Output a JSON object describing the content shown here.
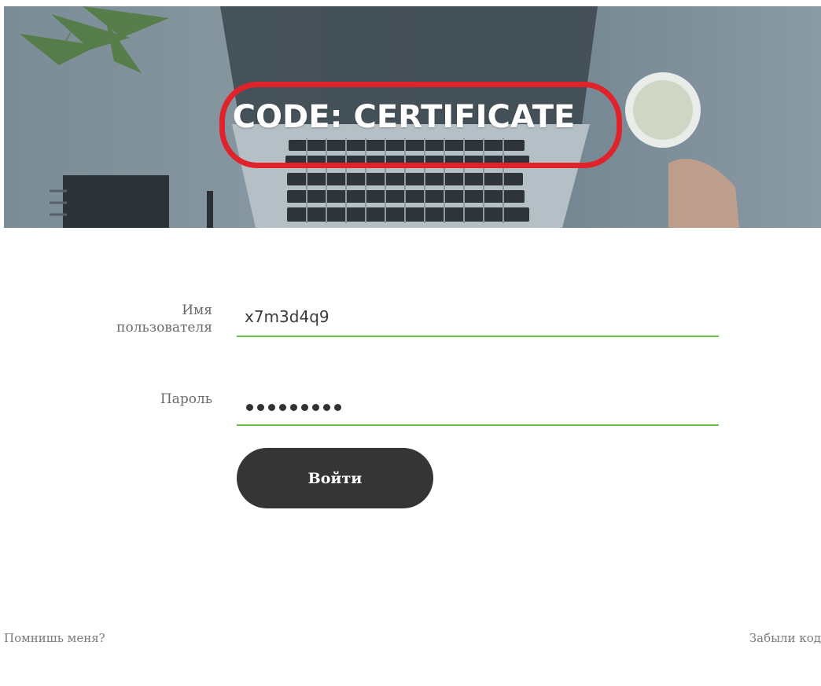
{
  "banner": {
    "title": "CODE: CERTIFICATE"
  },
  "login_form": {
    "username_label_line1": "Имя",
    "username_label_line2": "пользователя",
    "username_value": "x7m3d4q9",
    "password_label": "Пароль",
    "password_length": 9,
    "submit_label": "Войти"
  },
  "footer": {
    "remember_me": "Помнишь меня?",
    "forgot_code": "Забыли код"
  },
  "colors": {
    "field_underline": "#6cc04a",
    "button_bg": "#363535",
    "highlight_ring": "#e0222b"
  }
}
